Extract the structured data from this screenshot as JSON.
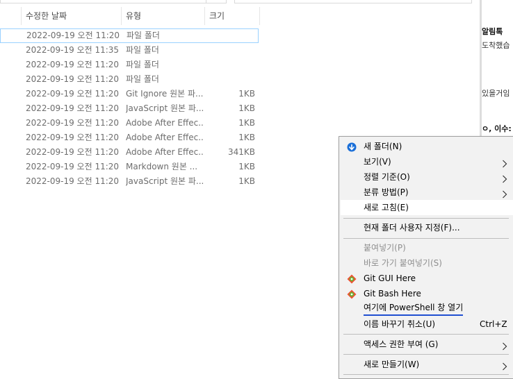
{
  "explorer": {
    "headers": {
      "date": "수정한 날짜",
      "type": "유형",
      "size": "크기"
    },
    "rows": [
      {
        "date": "2022-09-19 오전 11:20",
        "type": "파일 폴더",
        "size": ""
      },
      {
        "date": "2022-09-19 오전 11:35",
        "type": "파일 폴더",
        "size": ""
      },
      {
        "date": "2022-09-19 오전 11:20",
        "type": "파일 폴더",
        "size": ""
      },
      {
        "date": "2022-09-19 오전 11:20",
        "type": "파일 폴더",
        "size": ""
      },
      {
        "date": "2022-09-19 오전 11:20",
        "type": "Git Ignore 원본 파...",
        "size": "1KB"
      },
      {
        "date": "2022-09-19 오전 11:20",
        "type": "JavaScript 원본 파...",
        "size": "1KB"
      },
      {
        "date": "2022-09-19 오전 11:20",
        "type": "Adobe After Effec...",
        "size": "1KB"
      },
      {
        "date": "2022-09-19 오전 11:20",
        "type": "Adobe After Effec...",
        "size": "1KB"
      },
      {
        "date": "2022-09-19 오전 11:20",
        "type": "Adobe After Effec...",
        "size": "341KB"
      },
      {
        "date": "2022-09-19 오전 11:20",
        "type": "Markdown 원본 ...",
        "size": "1KB"
      },
      {
        "date": "2022-09-19 오전 11:20",
        "type": "JavaScript 원본 파...",
        "size": "1KB"
      }
    ]
  },
  "right_panel": {
    "line1": "알림톡",
    "line2": "도착했습",
    "line3": "있을거임",
    "line4": "ㅇ, 이수:"
  },
  "context_menu": {
    "new_folder": "새 폴더(N)",
    "view": "보기(V)",
    "sort_by": "정렬 기준(O)",
    "group_by": "분류 방법(P)",
    "refresh": "새로 고침(E)",
    "customize_folder": "현재 폴더 사용자 지정(F)...",
    "paste": "붙여넣기(P)",
    "paste_shortcut": "바로 가기 붙여넣기(S)",
    "git_gui": "Git GUI Here",
    "git_bash": "Git Bash Here",
    "powershell": "여기에 PowerShell 창 열기",
    "undo_rename": "이름 바꾸기 취소(U)",
    "undo_shortcut": "Ctrl+Z",
    "give_access": "액세스 권한 부여 (G)",
    "new": "새로 만들기(W)"
  },
  "icons": {
    "new_folder": "circle-arrow-icon",
    "git": "git-diamond-icon",
    "submenu": "chevron-right-icon"
  },
  "colors": {
    "focus_border": "#99d1ff",
    "powershell_underline": "#1f4fd1",
    "new_folder_icon": "#1a6fd8",
    "git_orange": "#f05133",
    "git_green": "#5fb832",
    "menu_background": "#f2f2f2"
  }
}
